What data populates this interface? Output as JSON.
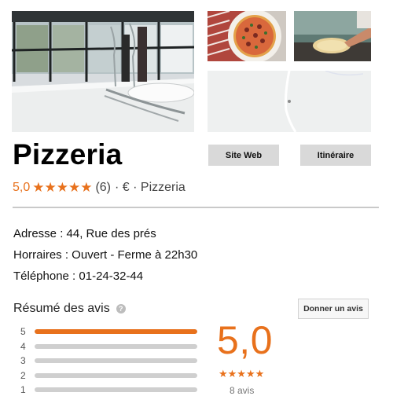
{
  "place": {
    "name": "Pizzeria",
    "rating": "5,0",
    "stars": "★★★★★",
    "review_count_paren": "(6)",
    "price_category": "· € · Pizzeria"
  },
  "actions": {
    "website_label": "Site Web",
    "directions_label": "Itinéraire"
  },
  "info": {
    "address": "Adresse : 44, Rue des prés",
    "hours": "Horraires : Ouvert - Ferme à 22h30",
    "phone": "Téléphone : 01-24-32-44"
  },
  "reviews": {
    "heading": "Résumé des avis",
    "help_icon": "question-icon",
    "write_review_label": "Donner un avis",
    "score": "5,0",
    "stars": "★★★★★",
    "count_label": "8 avis",
    "distribution": [
      {
        "stars": "5",
        "fraction": 1.0
      },
      {
        "stars": "4",
        "fraction": 0.0
      },
      {
        "stars": "3",
        "fraction": 0.0
      },
      {
        "stars": "2",
        "fraction": 0.0
      },
      {
        "stars": "1",
        "fraction": 0.0
      }
    ]
  },
  "colors": {
    "accent": "#e8711c",
    "button_bg": "#d9d9d9",
    "bar_track": "#cfcfcf"
  }
}
